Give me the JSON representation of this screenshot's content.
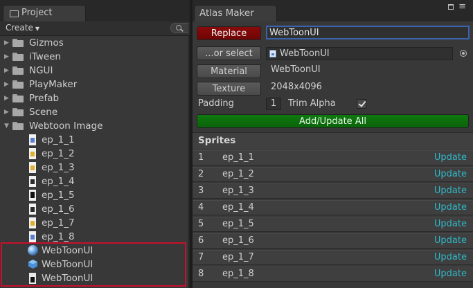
{
  "project": {
    "tab_label": "Project",
    "create_label": "Create",
    "tree": [
      {
        "label": "Gizmos",
        "kind": "folder",
        "expanded": false
      },
      {
        "label": "iTween",
        "kind": "folder",
        "expanded": false
      },
      {
        "label": "NGUI",
        "kind": "folder",
        "expanded": false
      },
      {
        "label": "PlayMaker",
        "kind": "folder",
        "expanded": false
      },
      {
        "label": "Prefab",
        "kind": "folder",
        "expanded": false
      },
      {
        "label": "Scene",
        "kind": "folder",
        "expanded": false
      },
      {
        "label": "Webtoon Image",
        "kind": "folder",
        "expanded": true
      }
    ],
    "children": [
      {
        "label": "ep_1_1"
      },
      {
        "label": "ep_1_2"
      },
      {
        "label": "ep_1_3"
      },
      {
        "label": "ep_1_4"
      },
      {
        "label": "ep_1_5"
      },
      {
        "label": "ep_1_6"
      },
      {
        "label": "ep_1_7"
      },
      {
        "label": "ep_1_8"
      }
    ],
    "selected_assets": [
      {
        "label": "WebToonUI",
        "icon": "material-sphere-icon"
      },
      {
        "label": "WebToonUI",
        "icon": "prefab-cube-icon"
      },
      {
        "label": "WebToonUI",
        "icon": "texture-icon"
      }
    ],
    "selection_color": "#c8102e"
  },
  "atlas_maker": {
    "tab_label": "Atlas Maker",
    "replace_label": "Replace",
    "atlas_name_value": "WebToonUI",
    "or_select_label": "...or select",
    "selected_atlas": "WebToonUI",
    "material_label": "Material",
    "material_value": "WebToonUI",
    "texture_label": "Texture",
    "texture_value": "2048x4096",
    "padding_label": "Padding",
    "padding_value": "1",
    "trim_alpha_label": "Trim Alpha",
    "trim_alpha_checked": true,
    "add_update_label": "Add/Update All",
    "sprites_header": "Sprites",
    "sprites": [
      {
        "index": "1",
        "name": "ep_1_1",
        "action": "Update"
      },
      {
        "index": "2",
        "name": "ep_1_2",
        "action": "Update"
      },
      {
        "index": "3",
        "name": "ep_1_3",
        "action": "Update"
      },
      {
        "index": "4",
        "name": "ep_1_4",
        "action": "Update"
      },
      {
        "index": "5",
        "name": "ep_1_5",
        "action": "Update"
      },
      {
        "index": "6",
        "name": "ep_1_6",
        "action": "Update"
      },
      {
        "index": "7",
        "name": "ep_1_7",
        "action": "Update"
      },
      {
        "index": "8",
        "name": "ep_1_8",
        "action": "Update"
      }
    ],
    "update_color": "#2fb8c8"
  }
}
